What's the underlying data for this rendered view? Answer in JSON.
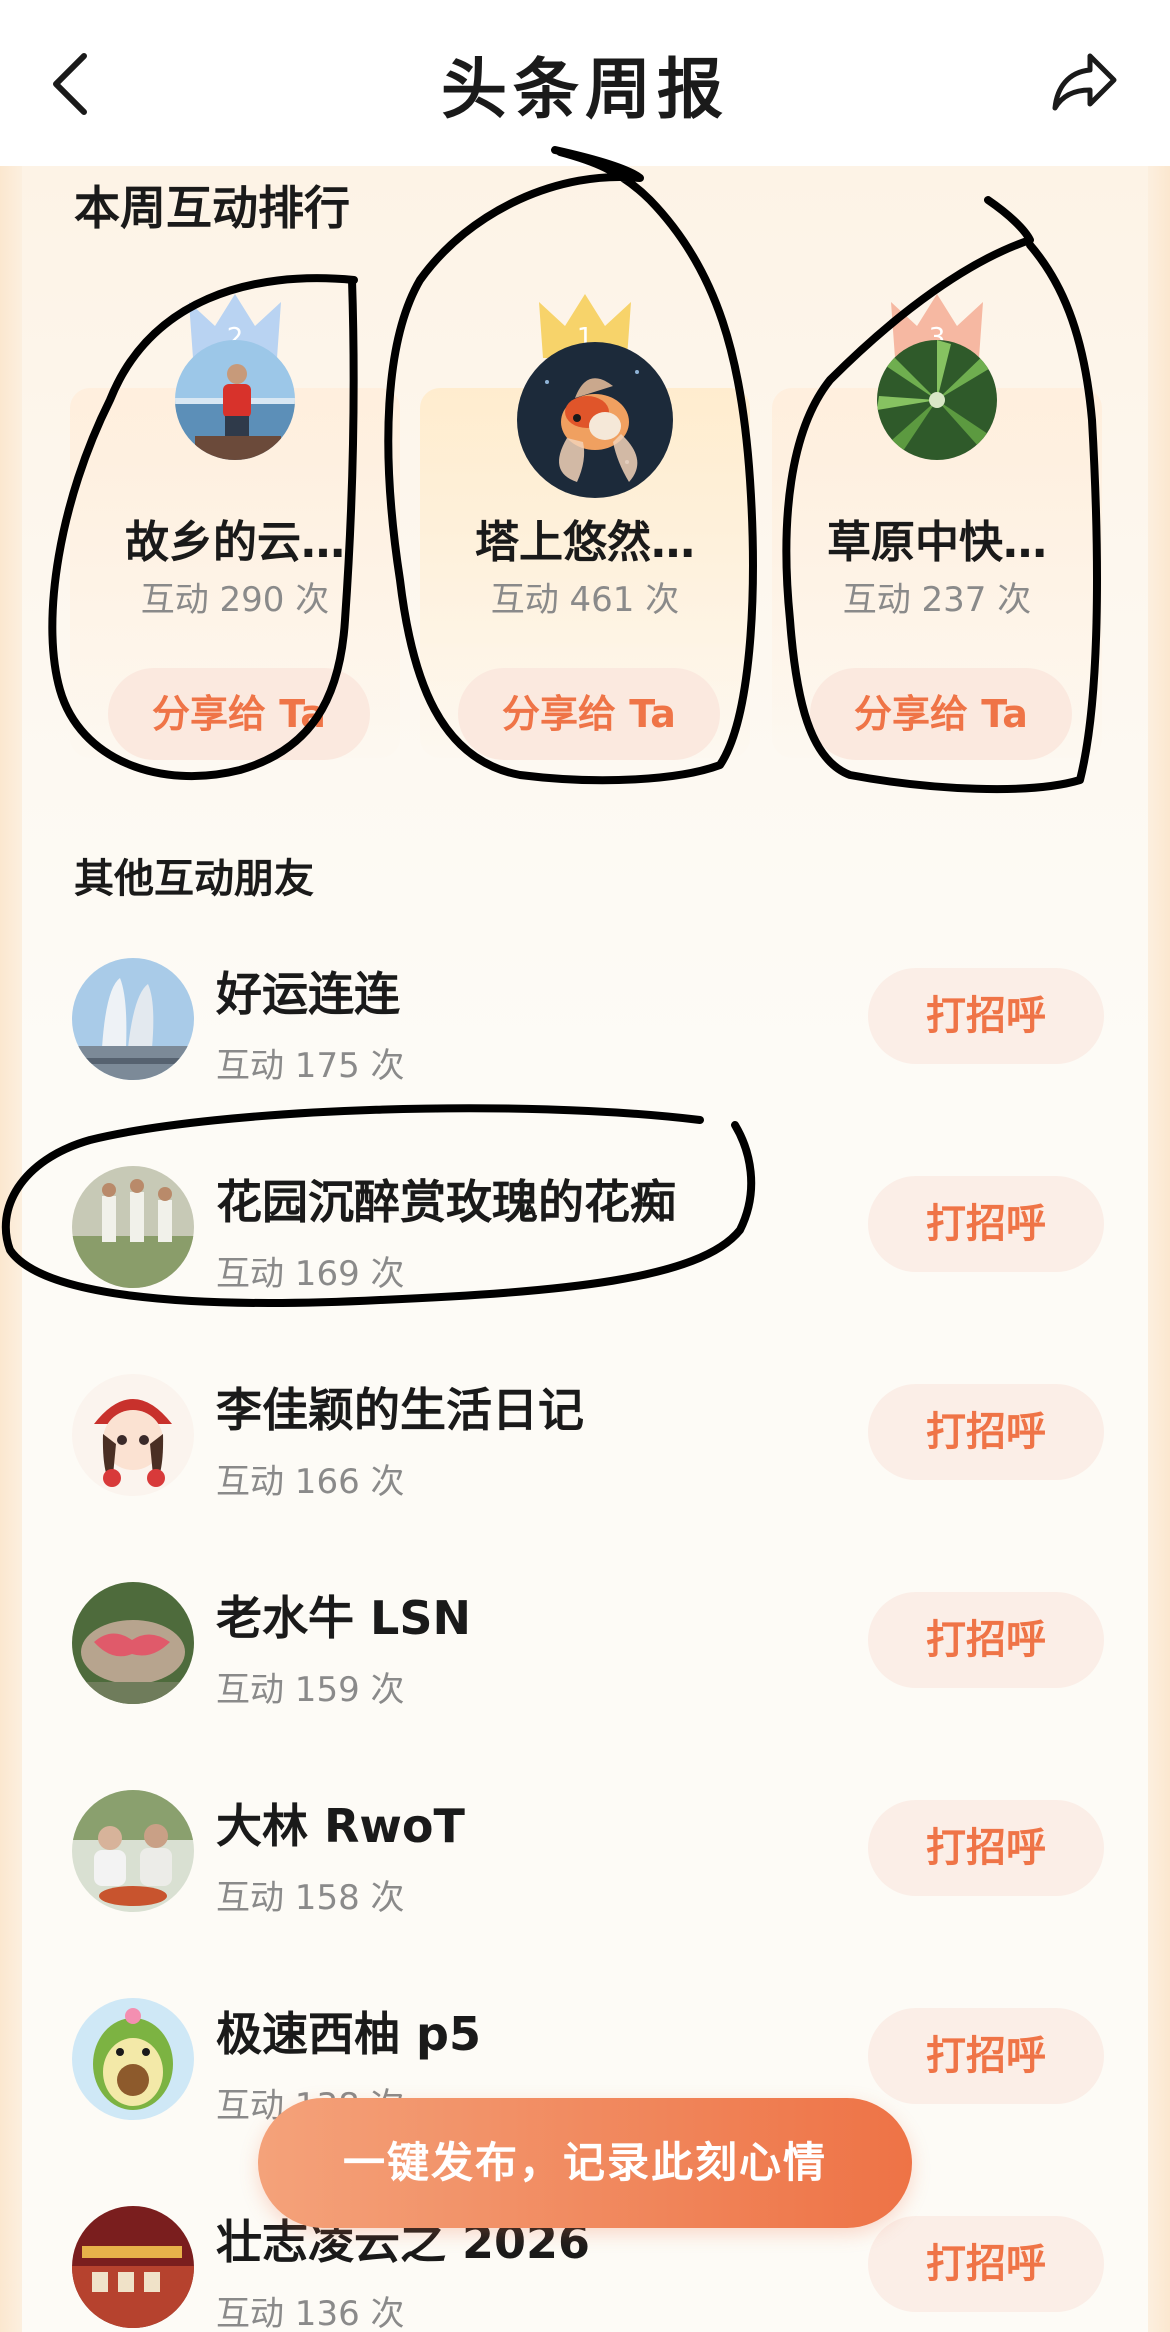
{
  "header": {
    "title": "头条周报",
    "back_icon": "chevron-left-icon",
    "share_icon": "share-arrow-icon"
  },
  "ranking": {
    "section_title": "本周互动排行",
    "cards": [
      {
        "rank": "2",
        "name": "故乡的云…",
        "count": "互动 290 次",
        "share_label": "分享给 Ta",
        "crown_color": "#b9d3f2"
      },
      {
        "rank": "1",
        "name": "塔上悠然…",
        "count": "互动 461 次",
        "share_label": "分享给 Ta",
        "crown_color": "#f7d36a"
      },
      {
        "rank": "3",
        "name": "草原中快…",
        "count": "互动 237 次",
        "share_label": "分享给 Ta",
        "crown_color": "#f6b8a2"
      }
    ]
  },
  "others": {
    "section_title": "其他互动朋友",
    "greet_label": "打招呼",
    "rows": [
      {
        "name": "好运连连",
        "count": "互动 175 次"
      },
      {
        "name": "花园沉醉赏玫瑰的花痴",
        "count": "互动 169 次"
      },
      {
        "name": "李佳颖的生活日记",
        "count": "互动 166 次"
      },
      {
        "name": "老水牛 LSN",
        "count": "互动 159 次"
      },
      {
        "name": "大林 RwoT",
        "count": "互动 158 次"
      },
      {
        "name": "极速西柚 p5",
        "count": "互动 138 次"
      },
      {
        "name": "壮志凌云之 2026",
        "count": "互动 136 次"
      }
    ]
  },
  "publish_button": {
    "label": "一键发布，记录此刻心情"
  },
  "colors": {
    "accent": "#ef7447",
    "button_bg": "#fbeee7",
    "muted_text": "#8a8a8a"
  }
}
